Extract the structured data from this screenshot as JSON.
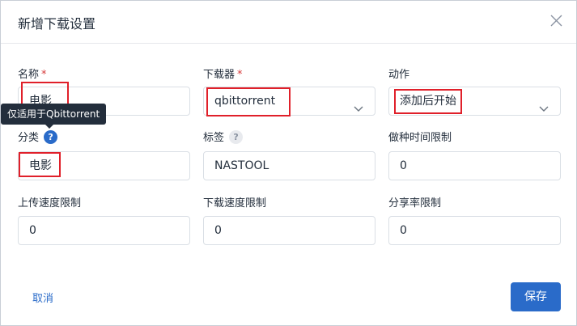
{
  "dialog": {
    "title": "新增下载设置"
  },
  "form": {
    "name": {
      "label": "名称",
      "required_mark": "*",
      "value": "电影"
    },
    "downloader": {
      "label": "下载器",
      "required_mark": "*",
      "value": "qbittorrent"
    },
    "action": {
      "label": "动作",
      "value": "添加后开始"
    },
    "category": {
      "label": "分类",
      "help": "?",
      "tooltip": "仅适用于Qbittorrent",
      "value": "电影"
    },
    "tags": {
      "label": "标签",
      "help": "?",
      "value": "NASTOOL"
    },
    "seed_time_limit": {
      "label": "做种时间限制",
      "value": "0"
    },
    "upload_speed_limit": {
      "label": "上传速度限制",
      "value": "0"
    },
    "download_speed_limit": {
      "label": "下载速度限制",
      "value": "0"
    },
    "share_ratio_limit": {
      "label": "分享率限制",
      "value": "0"
    }
  },
  "footer": {
    "cancel_label": "取消",
    "save_label": "保存"
  },
  "colors": {
    "primary": "#2a6bc9",
    "required": "#d63939",
    "highlight_box": "#e0202a",
    "tooltip_bg": "#232e3c"
  },
  "icons": {
    "close": "close-icon",
    "chevron": "chevron-down-icon",
    "help": "help-icon"
  }
}
